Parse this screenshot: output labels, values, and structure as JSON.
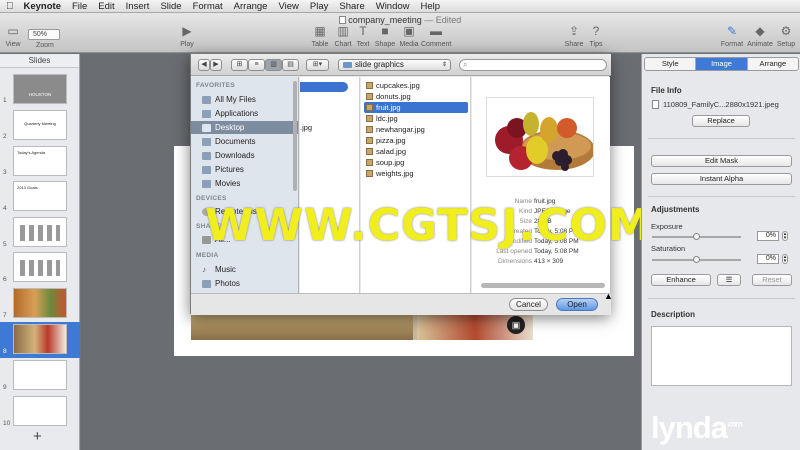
{
  "menubar": {
    "apple": "",
    "items": [
      "Keynote",
      "File",
      "Edit",
      "Insert",
      "Slide",
      "Format",
      "Arrange",
      "View",
      "Play",
      "Share",
      "Window",
      "Help"
    ]
  },
  "toolbar": {
    "doc_title": "company_meeting",
    "doc_status": "— Edited",
    "view_label": "View",
    "zoom_value": "50%",
    "zoom_label": "Zoom",
    "play_label": "Play",
    "insert": [
      "Table",
      "Chart",
      "Text",
      "Shape",
      "Media",
      "Comment"
    ],
    "share_label": "Share",
    "tips_label": "Tips",
    "format_label": "Format",
    "animate_label": "Animate",
    "setup_label": "Setup"
  },
  "slides_panel": {
    "header": "Slides",
    "numbers": [
      "1",
      "2",
      "3",
      "4",
      "5",
      "6",
      "7",
      "8",
      "9",
      "10"
    ],
    "thumb_texts": {
      "t1": "HOUSTON",
      "t2": "Quarterly Meeting",
      "t3": "Today's Agenda",
      "t4": "2013 Goals"
    },
    "selected": "8",
    "add_label": "+"
  },
  "file_dialog": {
    "path": "slide graphics",
    "search_placeholder": "",
    "sidebar": {
      "favorites_header": "FAVORITES",
      "favorites": [
        "All My Files",
        "Applications",
        "Desktop",
        "Documents",
        "Downloads",
        "Pictures",
        "Movies"
      ],
      "selected_favorite": "Desktop",
      "devices_header": "DEVICES",
      "devices": [
        "Remote Disc"
      ],
      "shared_header": "SHARED",
      "shared": [
        "All..."
      ],
      "media_header": "MEDIA",
      "media": [
        "Music",
        "Photos"
      ]
    },
    "column1_partial": ".jpg",
    "files": [
      "cupcakes.jpg",
      "donuts.jpg",
      "fruit.jpg",
      "ldc.jpg",
      "newhangar.jpg",
      "pizza.jpg",
      "salad.jpg",
      "soup.jpg",
      "weights.jpg"
    ],
    "selected_file": "fruit.jpg",
    "preview_meta": [
      {
        "key": "Name",
        "value": "fruit.jpg"
      },
      {
        "key": "Kind",
        "value": "JPEG image"
      },
      {
        "key": "Size",
        "value": "28 KB"
      },
      {
        "key": "Created",
        "value": "Today, 5:08 PM"
      },
      {
        "key": "Modified",
        "value": "Today, 5:08 PM"
      },
      {
        "key": "Last opened",
        "value": "Today, 5:08 PM"
      },
      {
        "key": "Dimensions",
        "value": "413 × 309"
      }
    ],
    "cancel_label": "Cancel",
    "open_label": "Open"
  },
  "inspector": {
    "tabs": [
      "Style",
      "Image",
      "Arrange"
    ],
    "active_tab": "Image",
    "file_info_label": "File Info",
    "file_name": "110809_FamilyC...2880x1921.jpeg",
    "replace_label": "Replace",
    "edit_mask_label": "Edit Mask",
    "instant_alpha_label": "Instant Alpha",
    "adjustments_label": "Adjustments",
    "exposure_label": "Exposure",
    "exposure_value": "0%",
    "saturation_label": "Saturation",
    "saturation_value": "0%",
    "enhance_label": "Enhance",
    "reset_label": "Reset",
    "description_label": "Description"
  },
  "watermark": "WWW.CGTSJ.COM",
  "brand": {
    "name": "lynda",
    "suffix": ".com"
  },
  "colors": {
    "accent": "#3e79d4",
    "watermark": "#f1ee1e"
  }
}
